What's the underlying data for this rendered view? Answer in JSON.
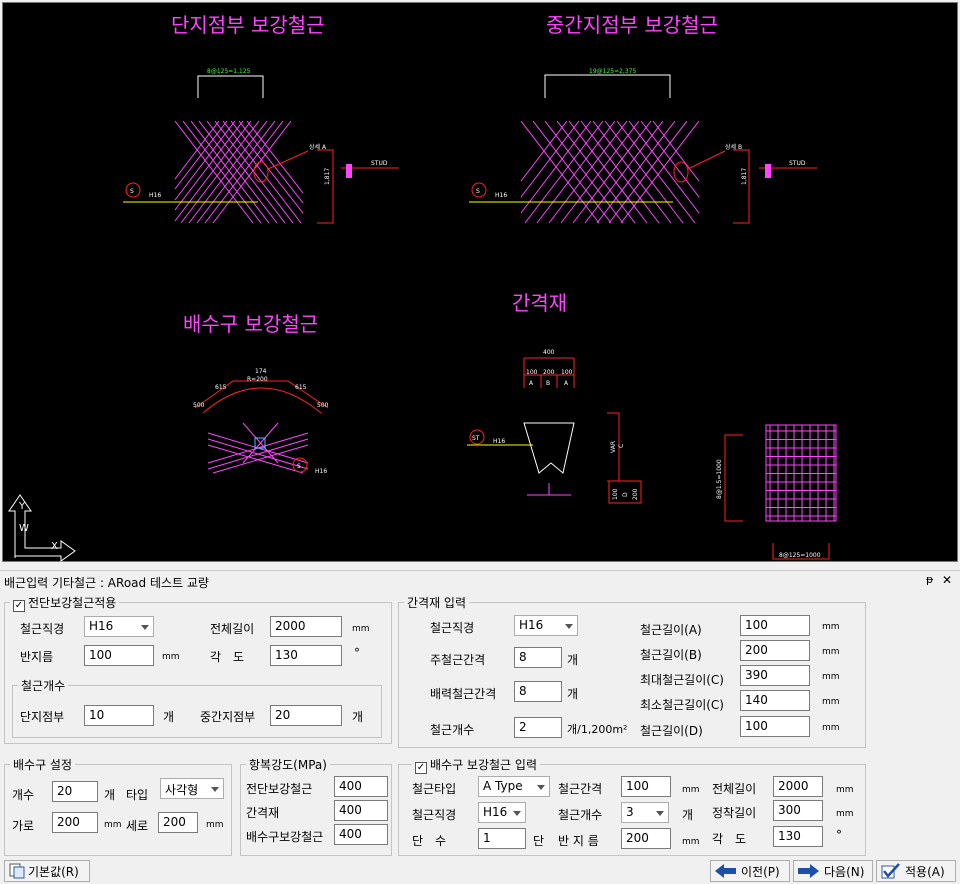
{
  "drawing": {
    "titles": {
      "end_support": "단지점부 보강철근",
      "mid_support": "중간지점부 보강철근",
      "drain": "배수구 보강철근",
      "spacer": "간격재"
    },
    "labels": {
      "dim_end": "8@125=1,125",
      "dim_mid": "19@125=2,375",
      "detail_a": "상세 A",
      "detail_b": "상세 B",
      "height": "1,817",
      "stud": "STUD",
      "rebar": "H16",
      "circle_s": "S",
      "circle_st": "ST",
      "sp_400": "400",
      "sp_100": "100",
      "sp_200": "200",
      "sp_a": "A",
      "sp_b": "B",
      "sp_c": "C",
      "sp_d": "D",
      "sp_var": "VAR",
      "dr_174": "174",
      "dr_r": "R=200",
      "dr_615": "615",
      "dr_500": "500",
      "mesh_bottom": "8@125=1000",
      "mesh_side": "8@1.5=1000",
      "axis_x": "X",
      "axis_y": "Y",
      "axis_w": "W"
    }
  },
  "panel": {
    "title": "배근입력 기타철근 : ARoad 테스트 교량",
    "pin_icon": "pin-icon",
    "close_icon": "close-icon"
  },
  "shear": {
    "check_label": "전단보강철근적용",
    "checked": true,
    "diameter_label": "철근직경",
    "diameter_value": "H16",
    "radius_label": "반지름",
    "radius_value": "100",
    "radius_unit": "mm",
    "length_label": "전체길이",
    "length_value": "2000",
    "length_unit": "mm",
    "angle_label": "각　도",
    "angle_value": "130",
    "angle_unit": "°",
    "count_group": "철근개수",
    "end_label": "단지점부",
    "end_value": "10",
    "end_unit": "개",
    "mid_label": "중간지점부",
    "mid_value": "20",
    "mid_unit": "개"
  },
  "spacer": {
    "group": "간격재 입력",
    "diameter_label": "철근직경",
    "diameter_value": "H16",
    "main_gap_label": "주철근간격",
    "main_gap_value": "8",
    "main_gap_unit": "개",
    "dist_gap_label": "배력철근간격",
    "dist_gap_value": "8",
    "dist_gap_unit": "개",
    "count_label": "철근개수",
    "count_value": "2",
    "count_unit": "개/1,200m²",
    "len_a_label": "철근길이(A)",
    "len_a_value": "100",
    "len_b_label": "철근길이(B)",
    "len_b_value": "200",
    "len_cmax_label": "최대철근길이(C)",
    "len_cmax_value": "390",
    "len_cmin_label": "최소철근길이(C)",
    "len_cmin_value": "140",
    "len_d_label": "철근길이(D)",
    "len_d_value": "100",
    "unit": "mm"
  },
  "drain_setting": {
    "group": "배수구 설정",
    "count_label": "개수",
    "count_value": "20",
    "count_unit": "개",
    "type_label": "타입",
    "type_value": "사각형",
    "width_label": "가로",
    "width_value": "200",
    "height_label": "세로",
    "height_value": "200",
    "unit": "mm"
  },
  "yield": {
    "group": "항복강도(MPa)",
    "shear_label": "전단보강철근",
    "shear_value": "400",
    "spacer_label": "간격재",
    "spacer_value": "400",
    "drain_label": "배수구보강철근",
    "drain_value": "400"
  },
  "drain_rebar": {
    "check_label": "배수구 보강철근 입력",
    "checked": true,
    "type_label": "철근타입",
    "type_value": "A Type",
    "gap_label": "철근간격",
    "gap_value": "100",
    "length_label": "전체길이",
    "length_value": "2000",
    "diameter_label": "철근직경",
    "diameter_value": "H16",
    "count_label": "철근개수",
    "count_value": "3",
    "count_unit": "개",
    "anchor_label": "정착길이",
    "anchor_value": "300",
    "steps_label": "단　수",
    "steps_value": "1",
    "steps_unit": "단",
    "radius_label": "반 지 름",
    "radius_value": "200",
    "angle_label": "각　도",
    "angle_value": "130",
    "angle_unit": "°",
    "unit": "mm"
  },
  "buttons": {
    "default": "기본값(R)",
    "prev": "이전(P)",
    "next": "다음(N)",
    "apply": "적용(A)"
  }
}
